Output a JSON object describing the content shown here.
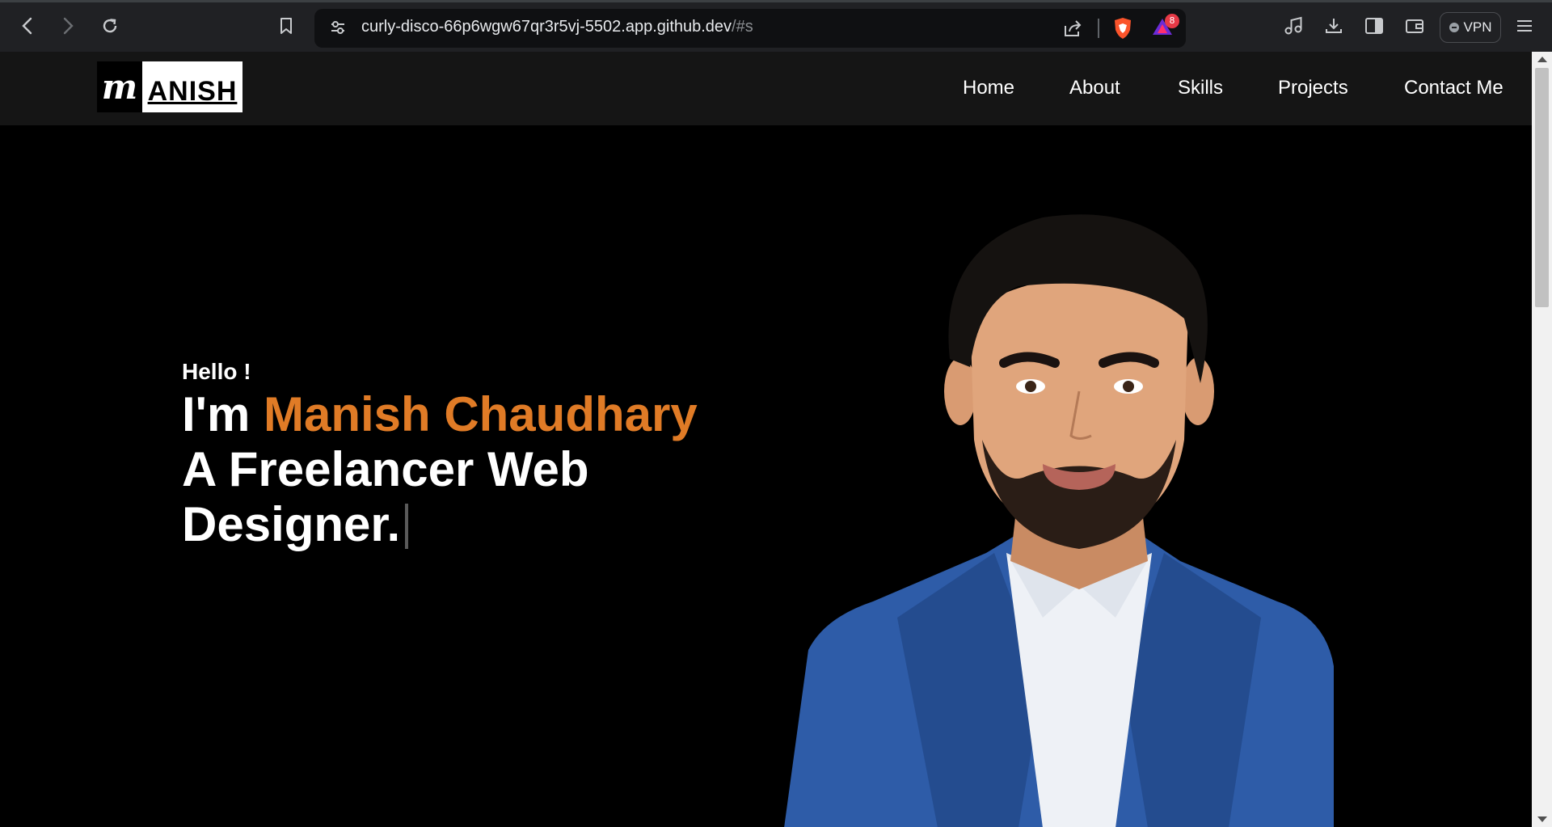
{
  "browser": {
    "url_main": "curly-disco-66p6wgw67qr3r5vj-5502.app.github.dev",
    "url_hash": "/#s",
    "rewards_badge": "8",
    "vpn_label": "VPN",
    "icons": [
      "back-icon",
      "forward-icon",
      "reload-icon",
      "bookmark-icon",
      "site-settings-icon",
      "share-icon",
      "brave-shields-icon",
      "brave-rewards-icon",
      "media-icon",
      "download-icon",
      "sidebar-icon",
      "wallet-icon",
      "menu-icon"
    ]
  },
  "site": {
    "logo_mark": "m",
    "logo_text": "ANISH",
    "nav": [
      "Home",
      "About",
      "Skills",
      "Projects",
      "Contact Me"
    ],
    "hero": {
      "greeting": "Hello !",
      "intro_prefix": "I'm ",
      "name": "Manish Chaudhary",
      "line2": "A Freelancer Web",
      "line3": "Designer."
    },
    "colors": {
      "accent": "#e07b26",
      "nav_bg": "#151515",
      "page_bg": "#000000",
      "suit": "#2e5ca8"
    }
  }
}
